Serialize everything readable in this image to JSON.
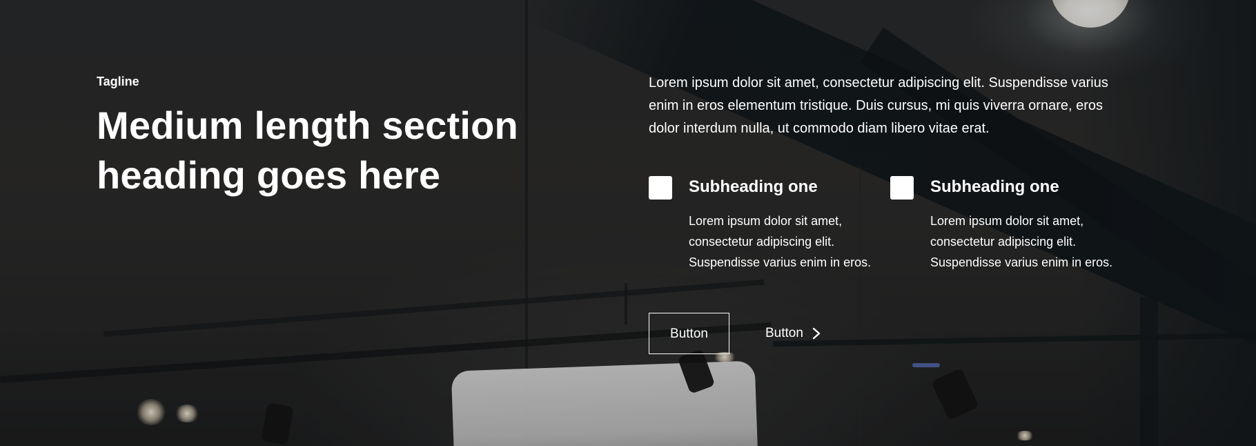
{
  "section": {
    "tagline": "Tagline",
    "heading_line1": "Medium length section",
    "heading_line2": "heading goes here",
    "intro": "Lorem ipsum dolor sit amet, consectetur adipiscing elit. Suspendisse varius enim in eros elementum tristique. Duis cursus, mi quis viverra ornare, eros dolor interdum nulla, ut commodo diam libero vitae erat."
  },
  "features": [
    {
      "icon": "square-placeholder-icon",
      "title": "Subheading one",
      "description": "Lorem ipsum dolor sit amet, consectetur adipiscing elit. Suspendisse varius enim in eros."
    },
    {
      "icon": "square-placeholder-icon",
      "title": "Subheading one",
      "description": "Lorem ipsum dolor sit amet, consectetur adipiscing elit. Suspendisse varius enim in eros."
    }
  ],
  "actions": {
    "primary_label": "Button",
    "secondary_label": "Button",
    "secondary_icon": "chevron-right-icon"
  },
  "colors": {
    "text": "#ffffff",
    "background": "#2b2d2f"
  }
}
